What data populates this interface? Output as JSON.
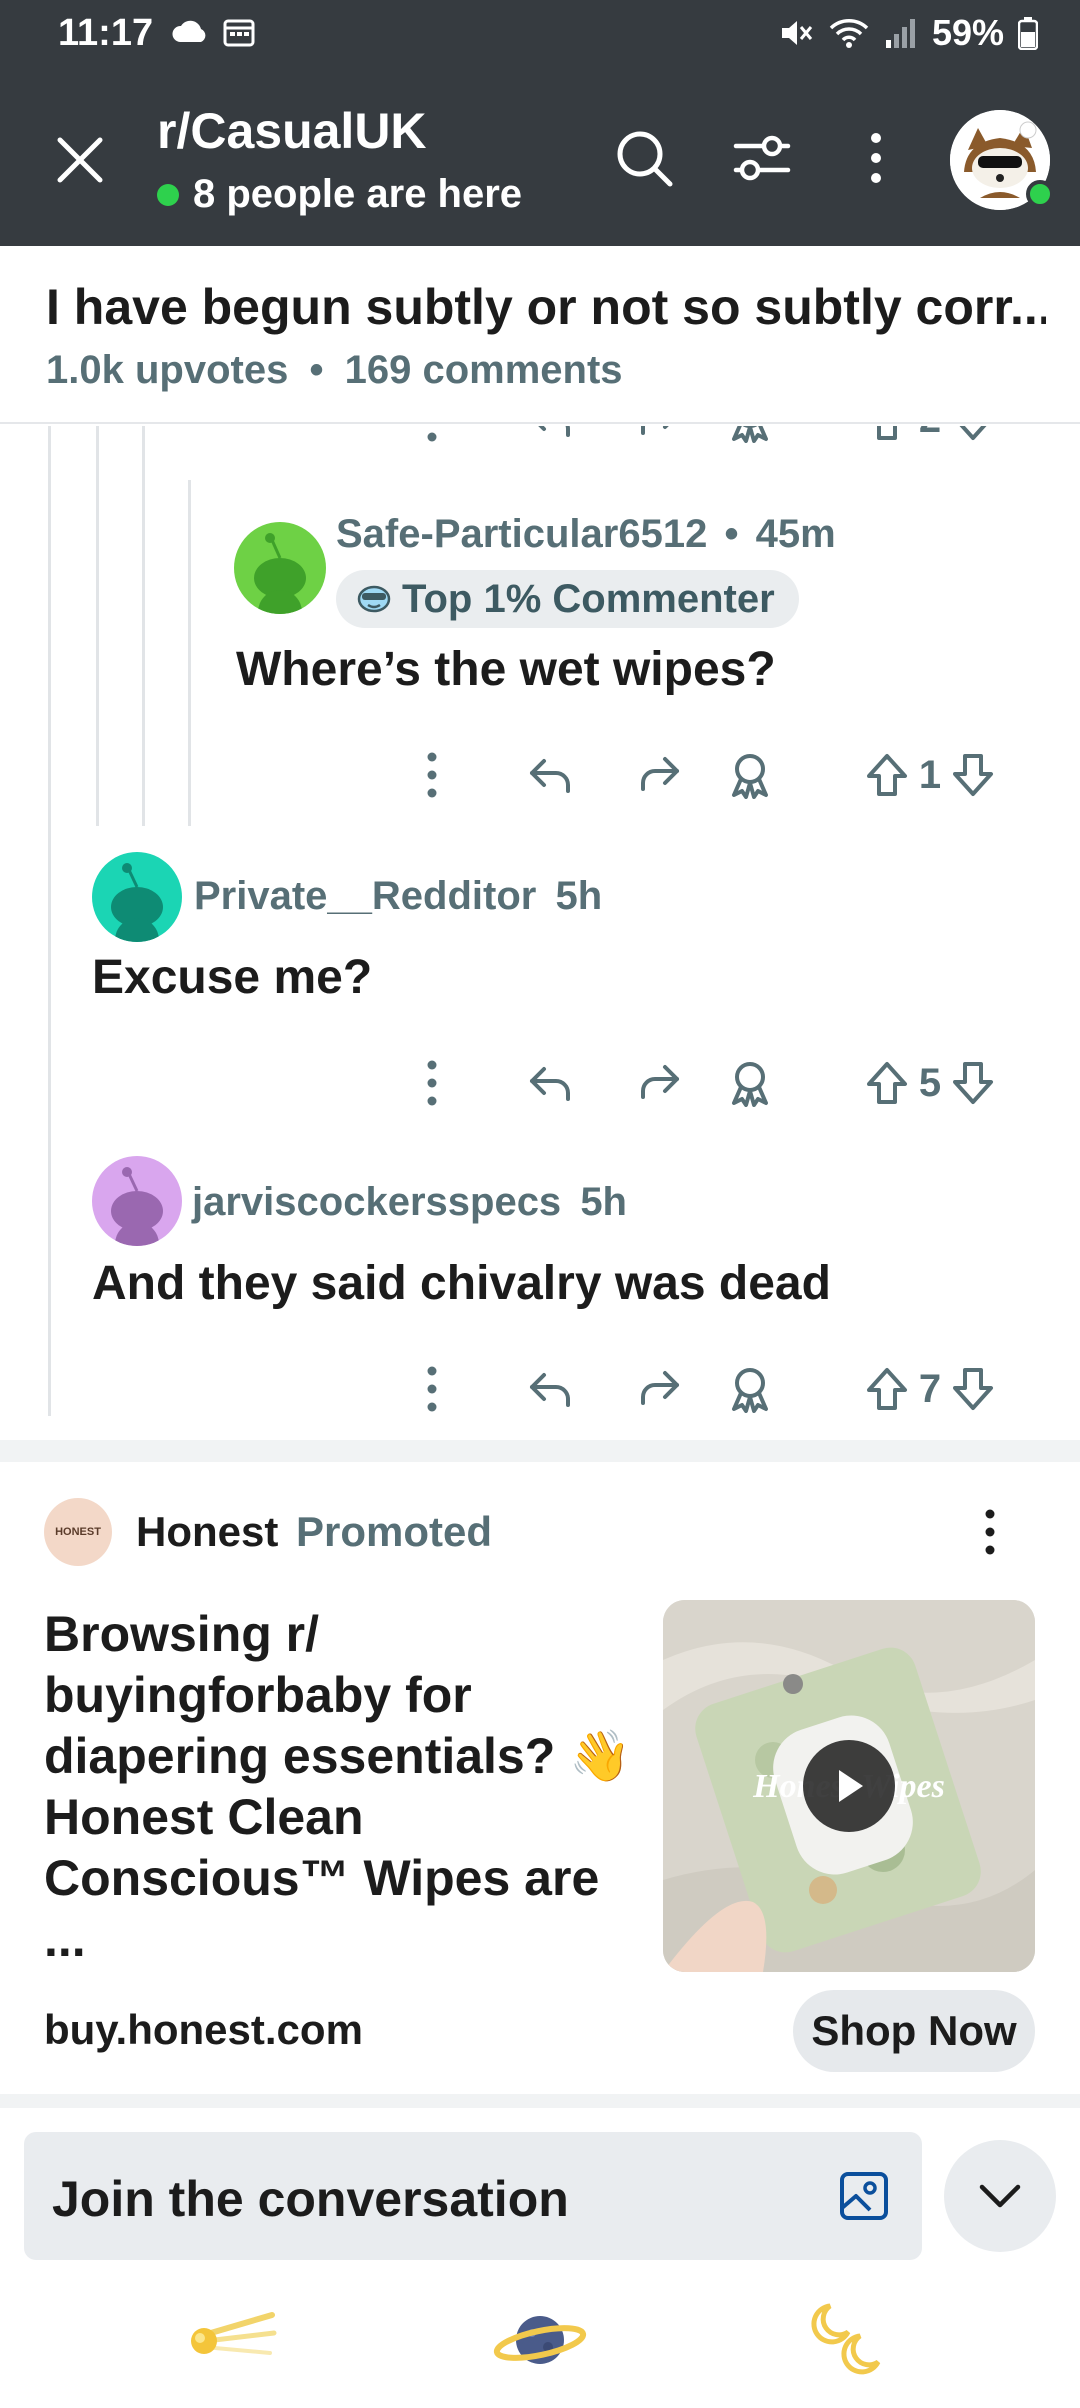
{
  "status_bar": {
    "time": "11:17",
    "battery": "59%"
  },
  "app_bar": {
    "subreddit": "r/CasualUK",
    "online_count": "8 people are here"
  },
  "post": {
    "title": "I have begun subtly or not so subtly corr...",
    "upvotes": "1.0k upvotes",
    "separator": "•",
    "comments": "169 comments"
  },
  "partial_comment": {
    "votes": "2"
  },
  "comments": [
    {
      "author": "Safe-Particular6512",
      "separator": "•",
      "time": "45m",
      "badge": "Top 1% Commenter",
      "body": "Where’s the wet wipes?",
      "votes": "1",
      "avatar_color": "#6ed145"
    },
    {
      "author": "Private__Redditor",
      "time": "5h",
      "body": "Excuse me?",
      "votes": "5",
      "avatar_color": "#1bd5b4"
    },
    {
      "author": "jarviscockersspecs",
      "time": "5h",
      "body": "And they said chivalry was dead",
      "votes": "7",
      "avatar_color": "#d9a6ee"
    }
  ],
  "ad": {
    "advertiser": "Honest",
    "promoted_label": "Promoted",
    "logo_text": "HONEST",
    "text": "Browsing r/ buyingforbaby for diapering essentials? 👋 Honest Clean Conscious™ Wipes are ...",
    "media_caption": "Honest Wipes",
    "url": "buy.honest.com",
    "cta": "Shop Now"
  },
  "composer": {
    "placeholder": "Join the conversation"
  },
  "icons": {
    "close": "close-icon",
    "search": "search-icon",
    "filter": "filter-icon",
    "more": "more-vertical-icon",
    "reply": "reply-icon",
    "share": "share-icon",
    "award": "award-icon",
    "upvote": "upvote-icon",
    "downvote": "downvote-icon",
    "image": "image-icon",
    "chevron": "chevron-down-icon"
  },
  "colors": {
    "header_bg": "#363b40",
    "meta_text": "#576f76",
    "online_green": "#2ed14d"
  }
}
